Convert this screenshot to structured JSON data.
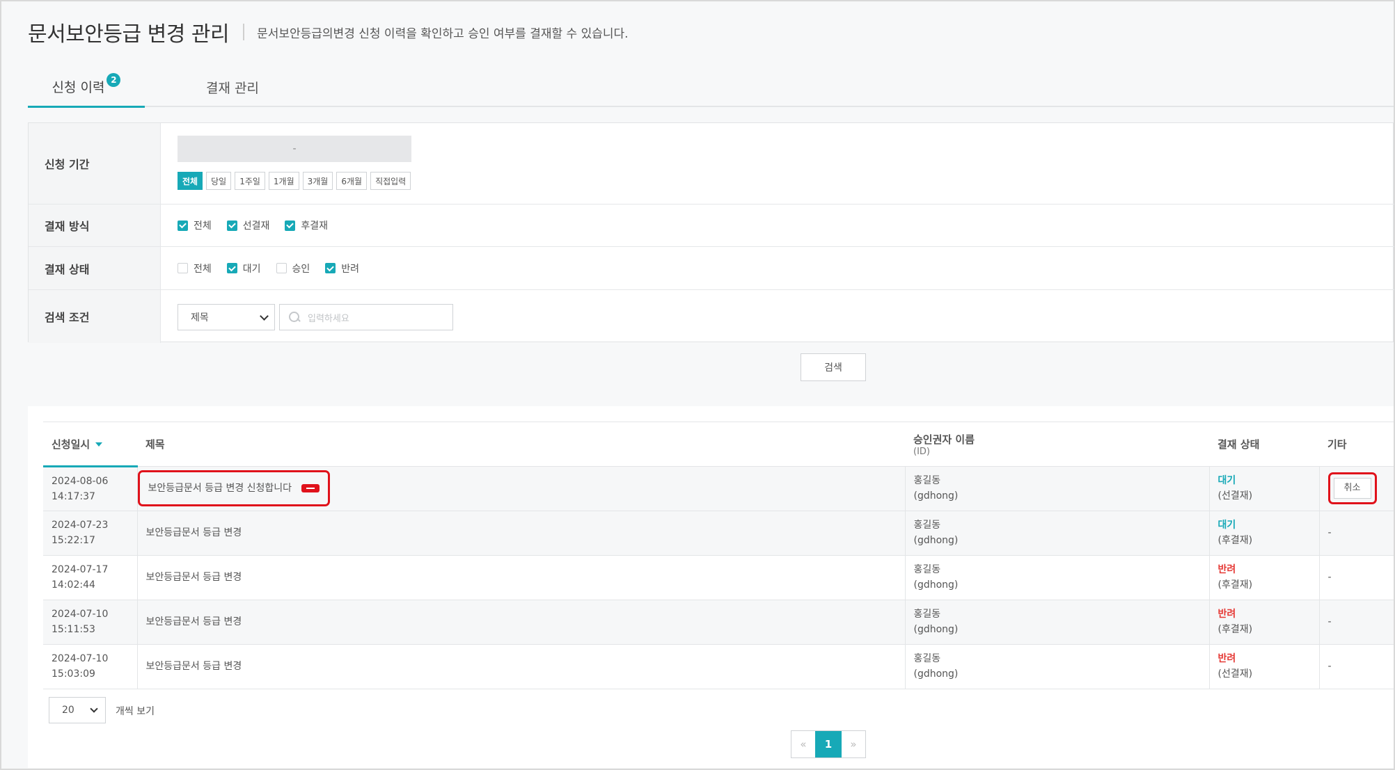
{
  "header": {
    "title": "문서보안등급 변경 관리",
    "description": "문서보안등급의변경 신청 이력을 확인하고 승인 여부를 결재할 수 있습니다."
  },
  "tabs": [
    {
      "label": "신청 이력",
      "badge": "2",
      "active": true
    },
    {
      "label": "결재 관리",
      "active": false
    }
  ],
  "filter": {
    "period": {
      "label": "신청 기간",
      "date_separator": "-",
      "buttons": [
        "전체",
        "당일",
        "1주일",
        "1개월",
        "3개월",
        "6개월",
        "직접입력"
      ],
      "active_index": 0
    },
    "method": {
      "label": "결재 방식",
      "options": [
        {
          "label": "전체",
          "checked": true
        },
        {
          "label": "선결재",
          "checked": true
        },
        {
          "label": "후결재",
          "checked": true
        }
      ]
    },
    "status": {
      "label": "결재 상태",
      "options": [
        {
          "label": "전체",
          "checked": false
        },
        {
          "label": "대기",
          "checked": true
        },
        {
          "label": "승인",
          "checked": false
        },
        {
          "label": "반려",
          "checked": true
        }
      ]
    },
    "search": {
      "label": "검색 조건",
      "field_selected": "제목",
      "placeholder": "입력하세요"
    },
    "search_button": "검색"
  },
  "table": {
    "columns": {
      "date": "신청일시",
      "title": "제목",
      "approver": "승인권자 이름",
      "approver_sub": "(ID)",
      "status": "결재 상태",
      "etc": "기타"
    },
    "rows": [
      {
        "date": "2024-08-06",
        "time": "14:17:37",
        "title": "보안등급문서 등급 변경 신청합니다",
        "approver": "홍길동",
        "approver_id": "(gdhong)",
        "status": "대기",
        "method": "(선결재)",
        "etc": "취소"
      },
      {
        "date": "2024-07-23",
        "time": "15:22:17",
        "title": "보안등급문서 등급 변경",
        "approver": "홍길동",
        "approver_id": "(gdhong)",
        "status": "대기",
        "method": "(후결재)",
        "etc": "-"
      },
      {
        "date": "2024-07-17",
        "time": "14:02:44",
        "title": "보안등급문서 등급 변경",
        "approver": "홍길동",
        "approver_id": "(gdhong)",
        "status": "반려",
        "method": "(후결재)",
        "etc": "-"
      },
      {
        "date": "2024-07-10",
        "time": "15:11:53",
        "title": "보안등급문서 등급 변경",
        "approver": "홍길동",
        "approver_id": "(gdhong)",
        "status": "반려",
        "method": "(후결재)",
        "etc": "-"
      },
      {
        "date": "2024-07-10",
        "time": "15:03:09",
        "title": "보안등급문서 등급 변경",
        "approver": "홍길동",
        "approver_id": "(gdhong)",
        "status": "반려",
        "method": "(선결재)",
        "etc": "-"
      }
    ]
  },
  "pagination": {
    "page_size": "20",
    "page_size_label": "개씩 보기",
    "prev": "«",
    "current_page": "1",
    "next": "»"
  },
  "colors": {
    "accent": "#17a9b7",
    "reject": "#e53935",
    "highlight": "#e0121b"
  }
}
